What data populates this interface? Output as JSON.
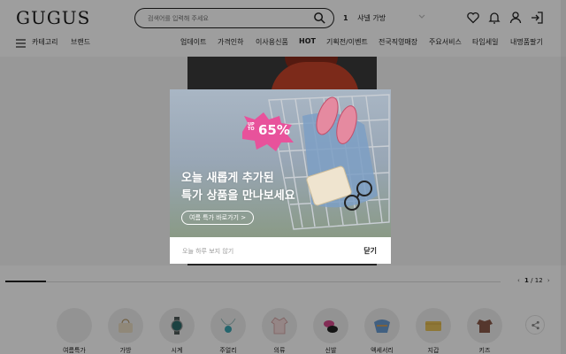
{
  "header": {
    "logo": "GUGUS",
    "search_placeholder": "검색어를 입력해 주세요",
    "rank_number": "1",
    "rank_text": "샤넬 가방"
  },
  "nav": {
    "left": [
      "카테고리",
      "브랜드"
    ],
    "items": [
      "업데이트",
      "가격인하",
      "이사용신품",
      "HOT",
      "기획전/이벤트",
      "전국직영매장",
      "주요서비스",
      "타임세일",
      "내명품팔기"
    ]
  },
  "modal": {
    "badge_up": "UP",
    "badge_to": "TO",
    "badge_pct": "65%",
    "title_line1": "오늘 새롭게 추가된",
    "title_line2": "특가 상품을 만나보세요",
    "cta": "여름 특가 바로가기 >",
    "dont_show": "오늘 하루 보지 않기",
    "close": "닫기"
  },
  "pager": {
    "current": "1",
    "separator": "/",
    "total": "12"
  },
  "categories": [
    {
      "label": "여름특가",
      "icon": "summer-sale-icon"
    },
    {
      "label": "가방",
      "icon": "bag-icon"
    },
    {
      "label": "시계",
      "icon": "watch-icon"
    },
    {
      "label": "주얼리",
      "icon": "necklace-icon"
    },
    {
      "label": "의류",
      "icon": "clothing-icon"
    },
    {
      "label": "신발",
      "icon": "shoes-icon"
    },
    {
      "label": "액세서리",
      "icon": "scarf-icon"
    },
    {
      "label": "지갑",
      "icon": "wallet-icon"
    },
    {
      "label": "키즈",
      "icon": "kids-icon"
    }
  ],
  "colors": {
    "badge_pink": "#e8529b",
    "overlay": "#000000"
  }
}
